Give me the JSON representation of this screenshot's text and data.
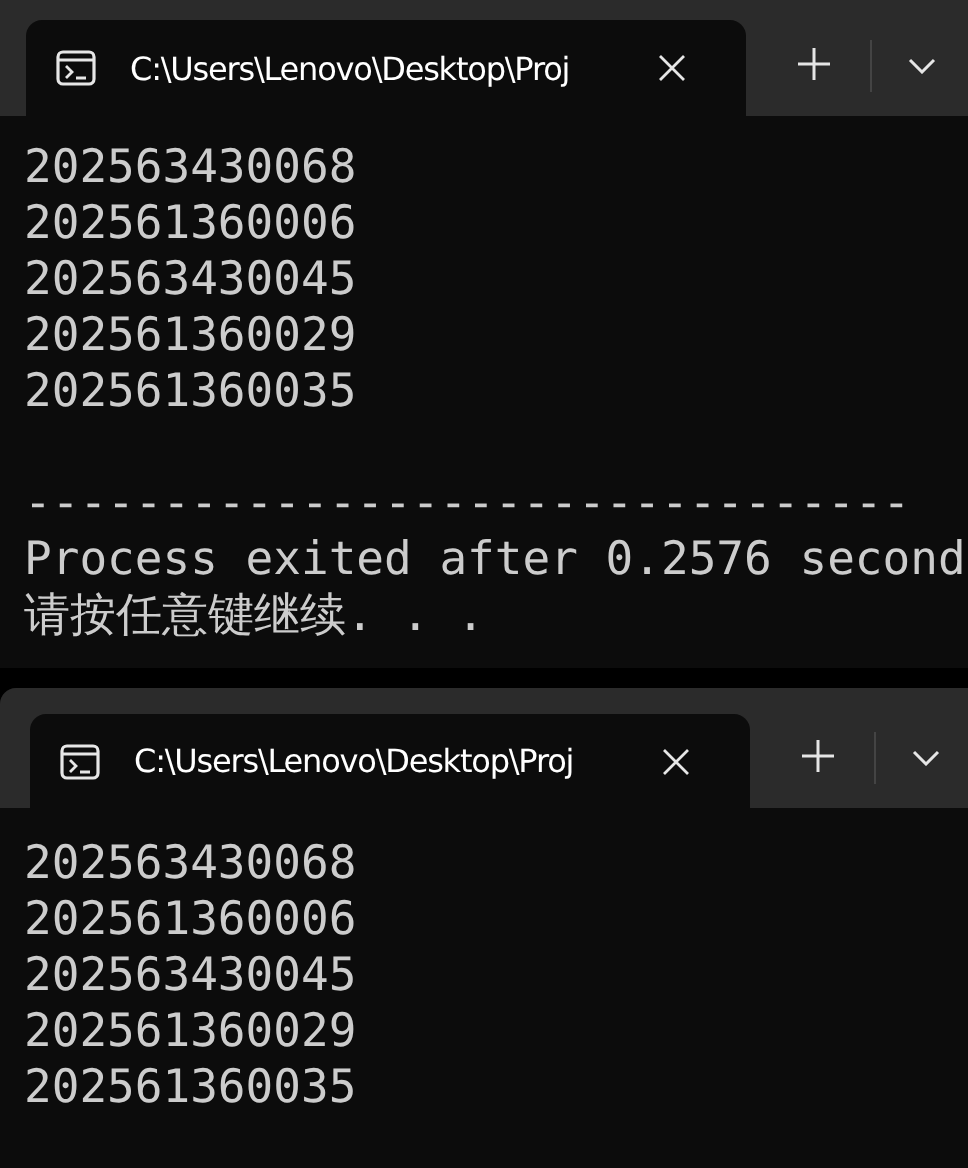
{
  "windows": [
    {
      "tab": {
        "title": "C:\\Users\\Lenovo\\Desktop\\Proj",
        "selected": true
      },
      "output": [
        "202563430068",
        "202561360006",
        "202563430045",
        "202561360029",
        "202561360035"
      ],
      "footer": {
        "rule": "--------------------------------",
        "lines": [
          "Process exited after 0.2576 second",
          "请按任意键继续. . ."
        ]
      }
    },
    {
      "tab": {
        "title": "C:\\Users\\Lenovo\\Desktop\\Proj",
        "selected": true
      },
      "output": [
        "202563430068",
        "202561360006",
        "202563430045",
        "202561360029",
        "202561360035"
      ]
    }
  ]
}
